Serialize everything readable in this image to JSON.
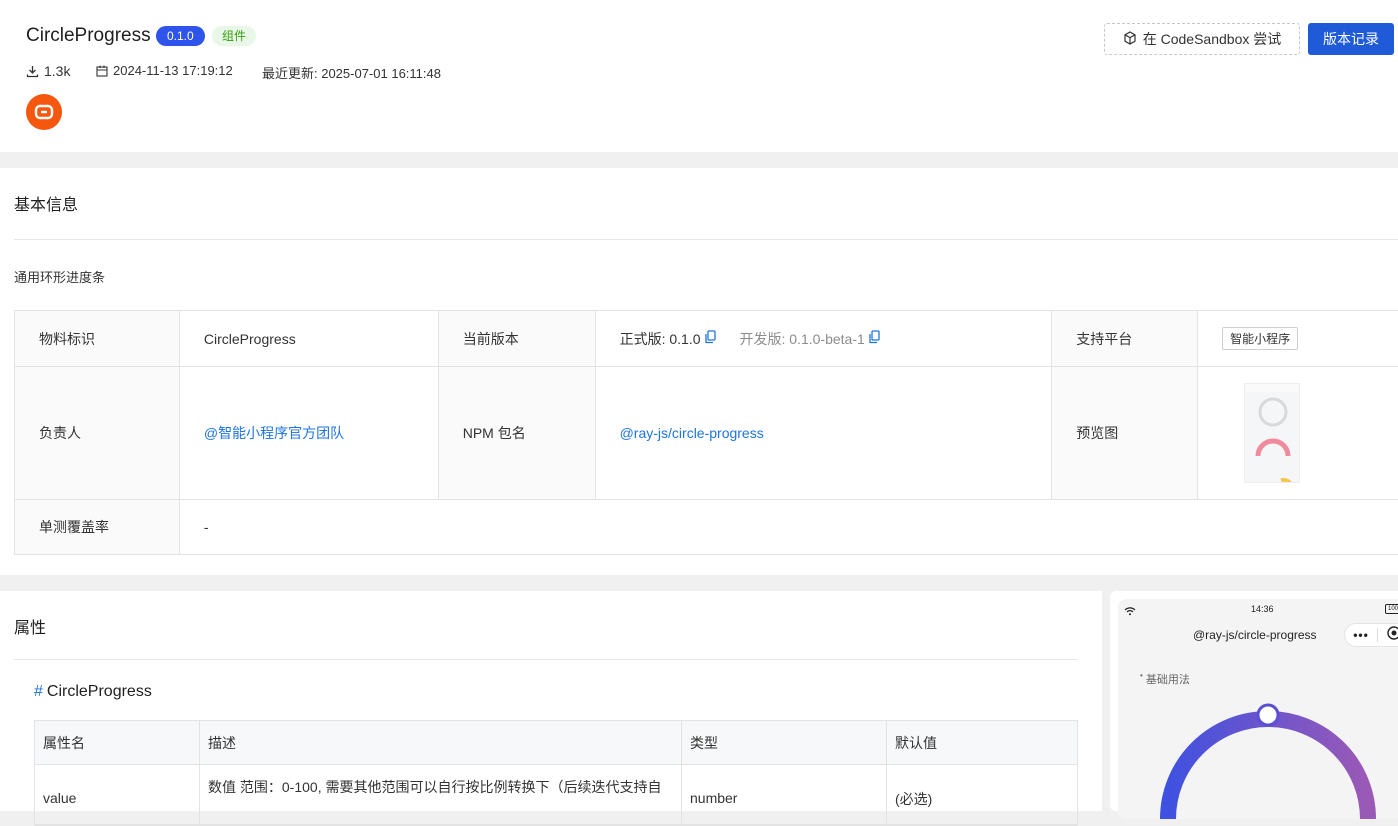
{
  "header": {
    "title": "CircleProgress",
    "version_badge": "0.1.0",
    "type_badge": "组件",
    "downloads": "1.3k",
    "created": "2024-11-13 17:19:12",
    "updated": "最近更新: 2025-07-01 16:11:48",
    "sandbox_button": "在 CodeSandbox 尝试",
    "versions_button": "版本记录"
  },
  "basic_info": {
    "title": "基本信息",
    "description": "通用环形进度条",
    "rows": [
      {
        "cells": [
          {
            "label": "物料标识",
            "value": "CircleProgress"
          },
          {
            "label": "当前版本",
            "stable": "正式版: 0.1.0",
            "dev": "开发版: 0.1.0-beta-1"
          },
          {
            "label": "支持平台",
            "tag": "智能小程序"
          }
        ]
      },
      {
        "cells": [
          {
            "label": "负责人",
            "value": "@智能小程序官方团队"
          },
          {
            "label": "NPM 包名",
            "value": "@ray-js/circle-progress"
          },
          {
            "label": "预览图"
          }
        ]
      },
      {
        "cells": [
          {
            "label": "单测覆盖率",
            "value": "-"
          }
        ]
      }
    ]
  },
  "props": {
    "title": "属性",
    "component_heading": "CircleProgress",
    "hash": "#",
    "columns": [
      "属性名",
      "描述",
      "类型",
      "默认值"
    ],
    "rows": [
      [
        "value",
        "数值 范围：0-100, 需要其他范围可以自行按比例转换下（后续迭代支持自",
        "number",
        "(必选)"
      ]
    ]
  },
  "phone_preview": {
    "time": "14:36",
    "battery": "100",
    "nav_title": "@ray-js/circle-progress",
    "section_label": "基础用法",
    "progress_value": 0.5,
    "colors": {
      "start": "#3f51e0",
      "end": "#9b59b6"
    }
  },
  "colors": {
    "primary": "#1f5bd8",
    "badge_blue": "#2f54eb",
    "badge_green_bg": "#e8f7e8",
    "badge_green_text": "#389e0d",
    "link": "#1f74e0",
    "logo": "#f5570f"
  }
}
